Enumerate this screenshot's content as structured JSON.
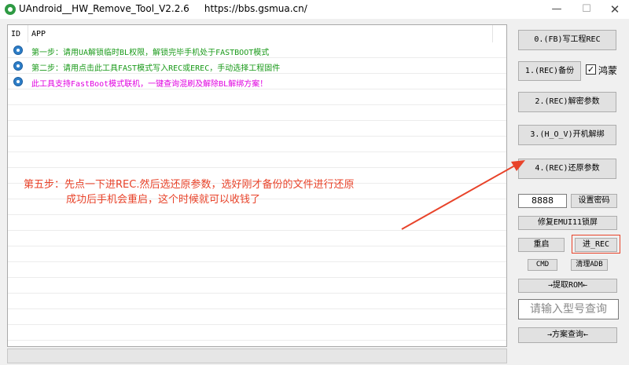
{
  "window": {
    "title": "UAndroid__HW_Remove_Tool_V2.2.6     https://bbs.gsmua.cn/",
    "minimize": "—",
    "maximize": "☐",
    "close": "✕"
  },
  "list": {
    "columns": [
      "ID",
      "APP"
    ],
    "rows": [
      {
        "text": "第一步：请用UA解锁临时BL权限，解锁完毕手机处于FASTBOOT模式",
        "color": "#1a9a1a"
      },
      {
        "text": "第二步：请用点击此工具FAST模式写入REC或EREC，手动选择工程固件",
        "color": "#1a9a1a"
      },
      {
        "text": "此工具支持FastBoot模式联机，一键查询混刷及解除BL解绑方案！",
        "color": "#e000e0"
      }
    ]
  },
  "annotation": {
    "line1": "第五步：先点一下进REC.然后选还原参数，选好刚才备份的文件进行还原",
    "line2": "成功后手机会重启，这个时候就可以收钱了",
    "color": "#e8432a"
  },
  "buttons": {
    "fb_write": "0.(FB)写工程REC",
    "rec_backup": "1.(REC)备份",
    "hongmeng_label": "鸿蒙",
    "hongmeng_checked": "✓",
    "rec_decrypt": "2.(REC)解密参数",
    "hov_unbind": "3.(H_O_V)开机解绑",
    "rec_restore": "4.(REC)还原参数",
    "password_value": "8888",
    "set_password": "设置密码",
    "repair_emui": "修复EMUI11锁屏",
    "reboot": "重启",
    "enter_rec": "进_REC",
    "cmd": "CMD",
    "clear_adb": "清理ADB",
    "extract_rom": "→提取ROM←",
    "model_placeholder": "请输入型号查询",
    "plan_query": "→方案查询←"
  }
}
